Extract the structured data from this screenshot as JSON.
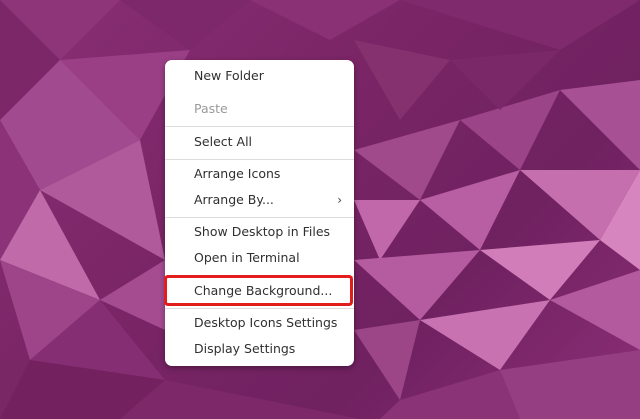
{
  "context_menu": {
    "items": [
      {
        "label": "New Folder",
        "enabled": true
      },
      {
        "label": "Paste",
        "enabled": false
      },
      {
        "label": "Select All",
        "enabled": true
      },
      {
        "label": "Arrange Icons",
        "enabled": true
      },
      {
        "label": "Arrange By...",
        "enabled": true,
        "submenu_arrow": "›"
      },
      {
        "label": "Show Desktop in Files",
        "enabled": true
      },
      {
        "label": "Open in Terminal",
        "enabled": true
      },
      {
        "label": "Change Background...",
        "enabled": true,
        "highlighted": true
      },
      {
        "label": "Desktop Icons Settings",
        "enabled": true
      },
      {
        "label": "Display Settings",
        "enabled": true
      }
    ]
  },
  "colors": {
    "wallpaper_base": "#7a2a66",
    "menu_background": "#ffffff",
    "menu_text": "#303030",
    "menu_text_disabled": "#9a9a9a",
    "highlight_border": "#e31c1c"
  }
}
